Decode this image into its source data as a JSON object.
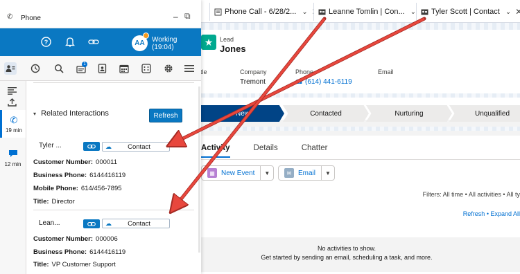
{
  "tabs": [
    {
      "label": "Phone Call - 6/28/2...",
      "icon": "phone-call-icon"
    },
    {
      "label": "Leanne Tomlin | Con...",
      "icon": "contact-card-icon"
    },
    {
      "label": "Tyler Scott | Contact",
      "icon": "contact-card-icon"
    }
  ],
  "lead": {
    "type": "Lead",
    "name": "Jones",
    "fields": [
      {
        "label": "itle",
        "value": ""
      },
      {
        "label": "Company",
        "value": "Tremont"
      },
      {
        "label": "Phone",
        "value": "(614) 441-6119"
      },
      {
        "label": "Email",
        "value": ""
      }
    ]
  },
  "path": {
    "stages": [
      "New",
      "Contacted",
      "Nurturing",
      "Unqualified"
    ],
    "current": "New"
  },
  "activity": {
    "tabs": [
      "Activity",
      "Details",
      "Chatter"
    ],
    "new_event": "New Event",
    "email": "Email",
    "filters": "Filters: All time • All activities • All ty",
    "refresh": "Refresh",
    "expand_all": "Expand All",
    "empty_line1": "No activities to show.",
    "empty_line2": "Get started by sending an email, scheduling a task, and more."
  },
  "phone": {
    "title": "Phone",
    "avatar_initials": "AA",
    "status": "Working",
    "status_time": "(19:04)",
    "toolbar_badge": "1",
    "side_items": [
      {
        "time": "19 min",
        "icon": "phone-call-icon"
      },
      {
        "time": "12 min",
        "icon": "chat-icon"
      }
    ],
    "related_interactions": {
      "heading": "Related Interactions",
      "refresh_label": "Refresh",
      "contacts": [
        {
          "name": "Tyler ...",
          "button_label": "Contact",
          "fields": [
            {
              "label": "Customer Number:",
              "value": "000011"
            },
            {
              "label": "Business Phone:",
              "value": "6144416119"
            },
            {
              "label": "Mobile Phone:",
              "value": "614/456-7895"
            },
            {
              "label": "Title:",
              "value": "Director"
            }
          ]
        },
        {
          "name": "Lean...",
          "button_label": "Contact",
          "fields": [
            {
              "label": "Customer Number:",
              "value": "000006"
            },
            {
              "label": "Business Phone:",
              "value": "6144416119"
            },
            {
              "label": "Title:",
              "value": "VP Customer Support"
            }
          ]
        }
      ]
    }
  },
  "colors": {
    "phone_header": "#0a78c2",
    "arrow": "#e8473d",
    "path_current": "#014486",
    "lead_icon": "#00a98f"
  }
}
